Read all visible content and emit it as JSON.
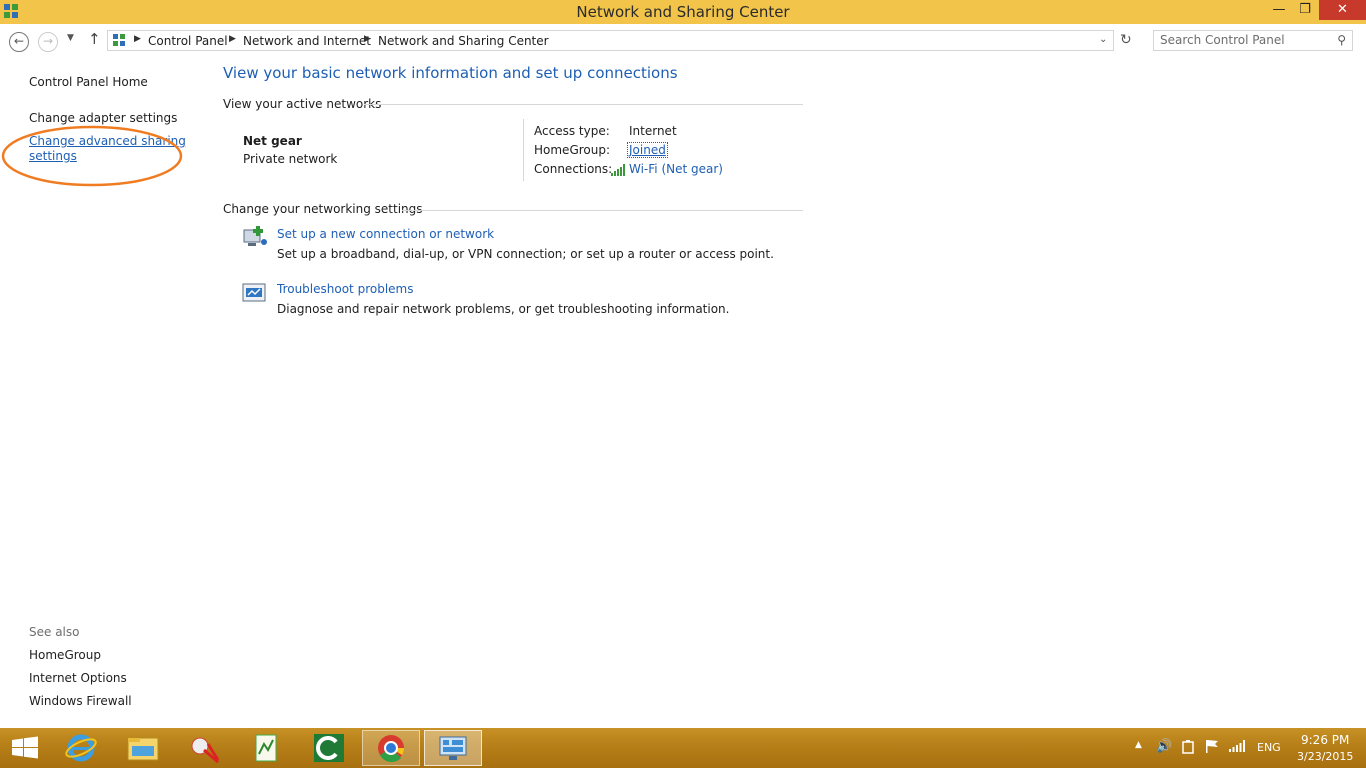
{
  "window": {
    "title": "Network and Sharing Center"
  },
  "address_bar": {
    "breadcrumbs": [
      "Control Panel",
      "Network and Internet",
      "Network and Sharing Center"
    ],
    "search_placeholder": "Search Control Panel"
  },
  "left_pane": {
    "home": "Control Panel Home",
    "adapter": "Change adapter settings",
    "advanced_line1": "Change advanced sharing",
    "advanced_line2": "settings",
    "see_also": "See also",
    "homegroup": "HomeGroup",
    "internet_options": "Internet Options",
    "firewall": "Windows Firewall"
  },
  "main": {
    "heading": "View your basic network information and set up connections",
    "active_networks_label": "View your active networks",
    "network": {
      "name": "Net gear",
      "type": "Private network",
      "access_type_label": "Access type:",
      "access_type_value": "Internet",
      "homegroup_label": "HomeGroup:",
      "homegroup_value": "Joined",
      "connections_label": "Connections:",
      "connections_value": "Wi-Fi (Net gear)"
    },
    "change_settings_label": "Change your networking settings",
    "tasks": [
      {
        "title": "Set up a new connection or network",
        "desc": "Set up a broadband, dial-up, or VPN connection; or set up a router or access point."
      },
      {
        "title": "Troubleshoot problems",
        "desc": "Diagnose and repair network problems, or get troubleshooting information."
      }
    ]
  },
  "taskbar": {
    "language": "ENG",
    "time": "9:26 PM",
    "date": "3/23/2015"
  },
  "colors": {
    "titlebar": "#f2c54a",
    "link": "#1e5fb4",
    "close": "#c7392b",
    "annotation": "#f07c22"
  }
}
